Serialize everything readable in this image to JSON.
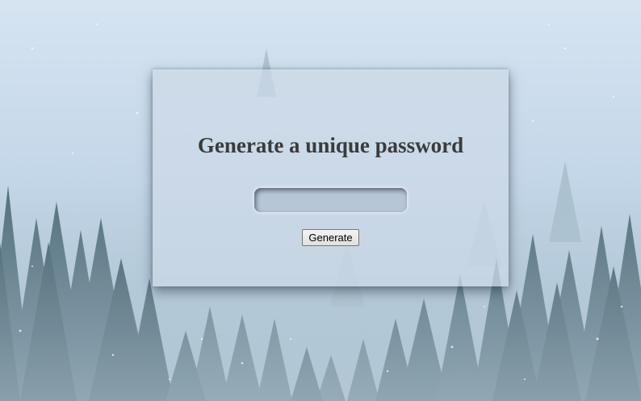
{
  "page": {
    "heading": "Generate a unique password"
  },
  "password_field": {
    "value": "",
    "placeholder": ""
  },
  "generate_button": {
    "label": "Generate"
  },
  "colors": {
    "sky_top": "#d3e1f0",
    "forest_dark": "#3d5a66",
    "card_tint": "#cddae8",
    "heading_text": "#3a3b3d"
  }
}
